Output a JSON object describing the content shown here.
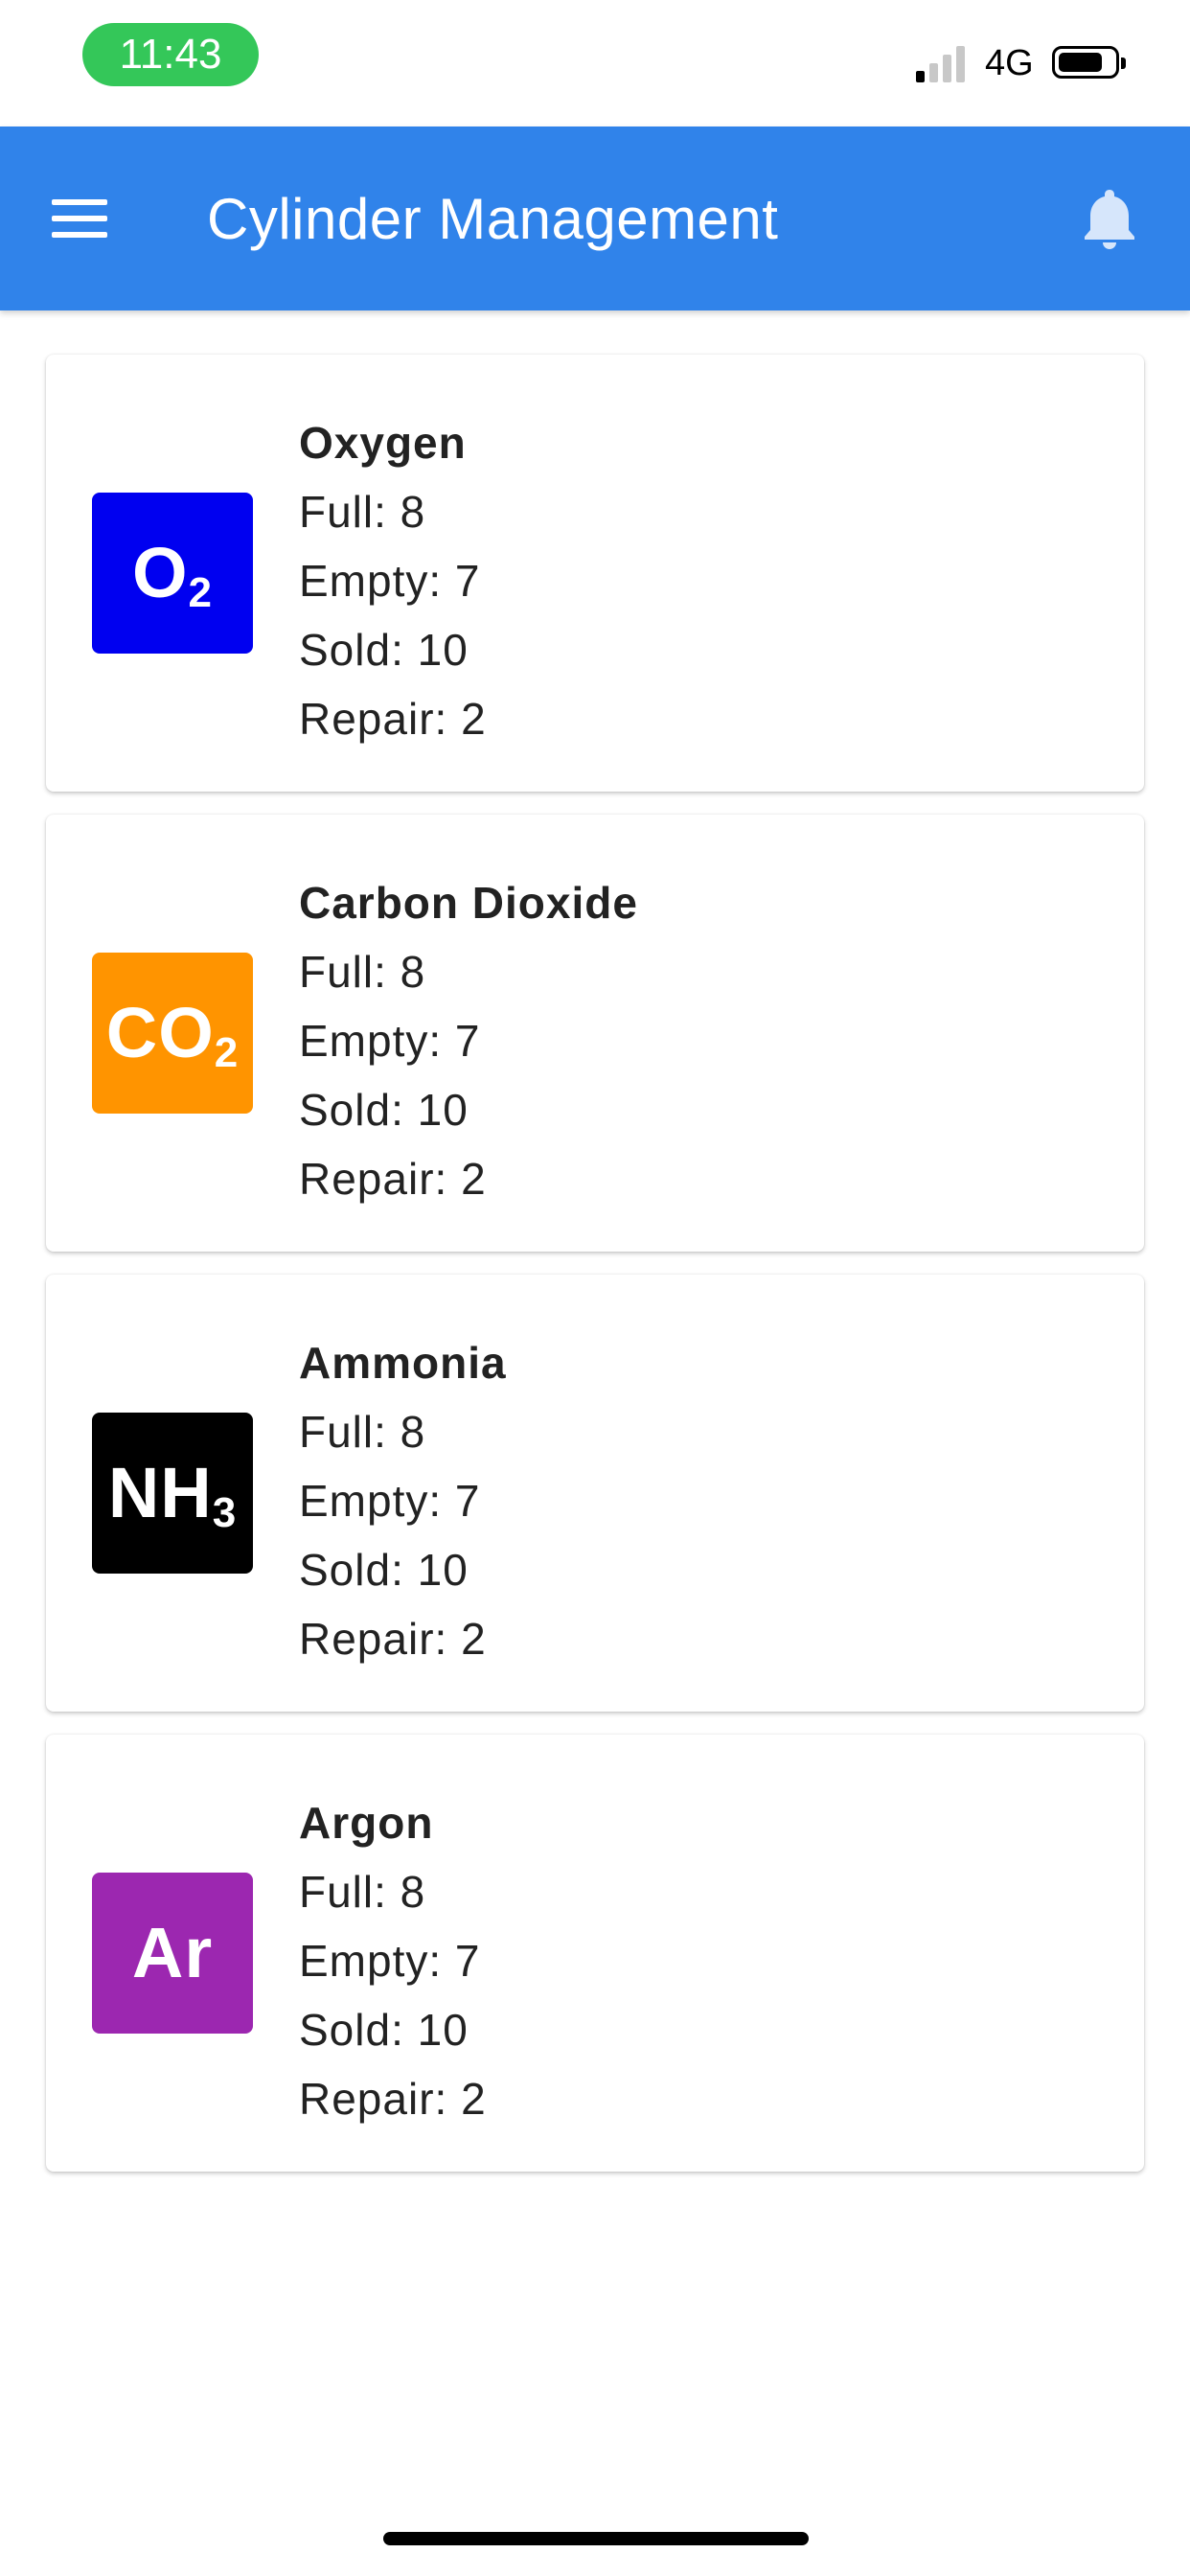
{
  "status_bar": {
    "time": "11:43",
    "network": "4G",
    "signal_bars_active": 1,
    "battery_level": 0.8,
    "time_pill_color": "#34c759"
  },
  "app_bar": {
    "title": "Cylinder Management",
    "menu_icon": "hamburger-menu-icon",
    "notification_icon": "bell-icon",
    "color": "#3083ea"
  },
  "gases": [
    {
      "name": "Oxygen",
      "symbol_main": "O",
      "symbol_sub": "2",
      "color": "#0000f0",
      "full": "Full: 8",
      "empty": "Empty: 7",
      "sold": "Sold: 10",
      "repair": "Repair: 2"
    },
    {
      "name": "Carbon Dioxide",
      "symbol_main": "CO",
      "symbol_sub": "2",
      "color": "#ff9400",
      "full": "Full: 8",
      "empty": "Empty: 7",
      "sold": "Sold: 10",
      "repair": "Repair: 2"
    },
    {
      "name": "Ammonia",
      "symbol_main": "NH",
      "symbol_sub": "3",
      "color": "#000000",
      "full": "Full: 8",
      "empty": "Empty: 7",
      "sold": "Sold: 10",
      "repair": "Repair: 2"
    },
    {
      "name": "Argon",
      "symbol_main": "Ar",
      "symbol_sub": "",
      "color": "#9c27b0",
      "full": "Full: 8",
      "empty": "Empty: 7",
      "sold": "Sold: 10",
      "repair": "Repair: 2"
    }
  ]
}
